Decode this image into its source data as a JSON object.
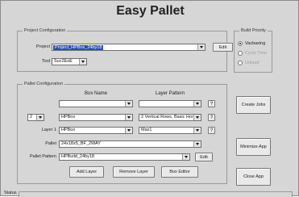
{
  "window": {
    "title": "Easy Pallet"
  },
  "project_config": {
    "legend": "Project Configuration",
    "project_label": "Project",
    "project_value": "Project_HPBox_24by18",
    "edit_label": "Edit",
    "tool_label": "Tool",
    "tool_value": "Suc2EoE"
  },
  "build_priority": {
    "legend": "Build Priority",
    "options": [
      {
        "label": "Vacbaxing",
        "selected": true,
        "enabled": true
      },
      {
        "label": "Cycle Time",
        "selected": false,
        "enabled": false
      },
      {
        "label": "Unload",
        "selected": false,
        "enabled": false
      }
    ]
  },
  "pallet_config": {
    "legend": "Pallet Configuration",
    "col_box_name": "Box Name",
    "col_layer_pattern": "Layer Pattern",
    "layers_count": "2",
    "row1": {
      "box": "HPBox",
      "pattern": "2 Vertical Rows, Basic Hor",
      "help": "?"
    },
    "row2": {
      "label": "Layer 1",
      "box": "HPBox",
      "pattern": "Max1",
      "help": "?"
    },
    "row0": {
      "help": "?"
    },
    "pallet_label": "Pallet",
    "pallet_value": "24x18x5_BF_2WAY",
    "pallet_pattern_label": "Pallet Pattern",
    "pallet_pattern_value": "HPBuild_24by18",
    "edit_label": "Edit",
    "add_layer": "Add Layer",
    "remove_layer": "Remove Layer",
    "box_editor": "Box Editor"
  },
  "side_buttons": {
    "create_jobs": "Create Jobs",
    "minimize_app": "Minimize App",
    "close_app": "Close App"
  },
  "status": {
    "label": "Status"
  }
}
